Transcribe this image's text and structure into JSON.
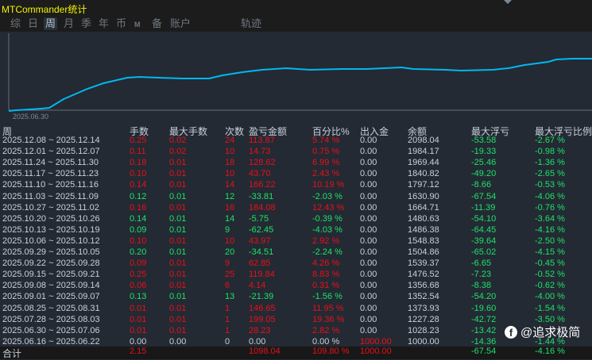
{
  "title": "MTCommander统计",
  "tabs": [
    {
      "label": "综",
      "active": false
    },
    {
      "label": "日",
      "active": false
    },
    {
      "label": "周",
      "active": true
    },
    {
      "label": "月",
      "active": false
    },
    {
      "label": "季",
      "active": false
    },
    {
      "label": "年",
      "active": false
    },
    {
      "label": "币",
      "active": false
    },
    {
      "label": "M",
      "active": false
    },
    {
      "label": "备",
      "active": false
    },
    {
      "label": "账户",
      "active": false
    },
    {
      "label": "轨迹",
      "active": false
    }
  ],
  "chart": {
    "start_label": "2025.06.30",
    "line_color": "#00b8f0"
  },
  "table": {
    "headers": [
      "周",
      "手数",
      "最大手数",
      "次数",
      "盈亏金额",
      "百分比%",
      "出入金",
      "余额",
      "最大浮亏",
      "最大浮亏比例"
    ],
    "rows": [
      [
        "2025.12.08 ~ 2025.12.14",
        "0.25",
        "0.02",
        "24",
        "113.87",
        "5.74 %",
        "0.00",
        "2098.04",
        "-53.58",
        "-2.67 %"
      ],
      [
        "2025.12.01 ~ 2025.12.07",
        "0.11",
        "0.02",
        "10",
        "14.73",
        "0.75 %",
        "0.00",
        "1984.17",
        "-19.33",
        "-0.98 %"
      ],
      [
        "2025.11.24 ~ 2025.11.30",
        "0.18",
        "0.01",
        "18",
        "128.62",
        "6.99 %",
        "0.00",
        "1969.44",
        "-25.46",
        "-1.36 %"
      ],
      [
        "2025.11.17 ~ 2025.11.23",
        "0.10",
        "0.01",
        "10",
        "43.70",
        "2.43 %",
        "0.00",
        "1840.82",
        "-49.20",
        "-2.65 %"
      ],
      [
        "2025.11.10 ~ 2025.11.16",
        "0.14",
        "0.01",
        "14",
        "166.22",
        "10.19 %",
        "0.00",
        "1797.12",
        "-8.66",
        "-0.53 %"
      ],
      [
        "2025.11.03 ~ 2025.11.09",
        "0.12",
        "0.01",
        "12",
        "-33.81",
        "-2.03 %",
        "0.00",
        "1630.90",
        "-67.54",
        "-4.06 %"
      ],
      [
        "2025.10.27 ~ 2025.11.02",
        "0.16",
        "0.01",
        "16",
        "184.08",
        "12.43 %",
        "0.00",
        "1664.71",
        "-11.39",
        "-0.76 %"
      ],
      [
        "2025.10.20 ~ 2025.10.26",
        "0.14",
        "0.01",
        "14",
        "-5.75",
        "-0.39 %",
        "0.00",
        "1480.63",
        "-54.10",
        "-3.64 %"
      ],
      [
        "2025.10.13 ~ 2025.10.19",
        "0.09",
        "0.01",
        "9",
        "-62.45",
        "-4.03 %",
        "0.00",
        "1486.38",
        "-64.45",
        "-4.16 %"
      ],
      [
        "2025.10.06 ~ 2025.10.12",
        "0.10",
        "0.01",
        "10",
        "43.97",
        "2.92 %",
        "0.00",
        "1548.83",
        "-39.64",
        "-2.50 %"
      ],
      [
        "2025.09.29 ~ 2025.10.05",
        "0.20",
        "0.01",
        "20",
        "-34.51",
        "-2.24 %",
        "0.00",
        "1504.86",
        "-65.02",
        "-4.15 %"
      ],
      [
        "2025.09.22 ~ 2025.09.28",
        "0.09",
        "0.01",
        "9",
        "62.85",
        "4.26 %",
        "0.00",
        "1539.37",
        "-6.65",
        "-0.45 %"
      ],
      [
        "2025.09.15 ~ 2025.09.21",
        "0.25",
        "0.01",
        "25",
        "119.84",
        "8.83 %",
        "0.00",
        "1476.52",
        "-7.23",
        "-0.52 %"
      ],
      [
        "2025.09.08 ~ 2025.09.14",
        "0.06",
        "0.01",
        "6",
        "4.14",
        "0.31 %",
        "0.00",
        "1356.68",
        "-8.38",
        "-0.62 %"
      ],
      [
        "2025.09.01 ~ 2025.09.07",
        "0.13",
        "0.01",
        "13",
        "-21.39",
        "-1.56 %",
        "0.00",
        "1352.54",
        "-54.20",
        "-4.00 %"
      ],
      [
        "2025.08.25 ~ 2025.08.31",
        "0.01",
        "0.01",
        "1",
        "146.65",
        "11.95 %",
        "0.00",
        "1373.93",
        "-19.60",
        "-1.54 %"
      ],
      [
        "2025.07.28 ~ 2025.08.03",
        "0.01",
        "0.01",
        "1",
        "199.05",
        "19.36 %",
        "0.00",
        "1227.28",
        "-42.72",
        "-3.50 %"
      ],
      [
        "2025.06.30 ~ 2025.07.06",
        "0.01",
        "0.01",
        "1",
        "28.23",
        "2.82 %",
        "0.00",
        "1028.23",
        "-13.42",
        ""
      ],
      [
        "2025.06.16 ~ 2025.06.22",
        "0.00",
        "0.00",
        "0",
        "0.00",
        "0.00 %",
        "1000.00",
        "1000.00",
        "-14.36",
        "-1.44 %"
      ]
    ],
    "total": [
      "合计",
      "2.15",
      "",
      "",
      "1098.04",
      "109.80 %",
      "1000.00",
      "",
      "-67.54",
      "-4.16 %"
    ]
  },
  "colors": {
    "profit": "#e8101a",
    "loss": "#1ee26a",
    "neutral": "#c8d0dc"
  },
  "watermark": "@追求极简"
}
